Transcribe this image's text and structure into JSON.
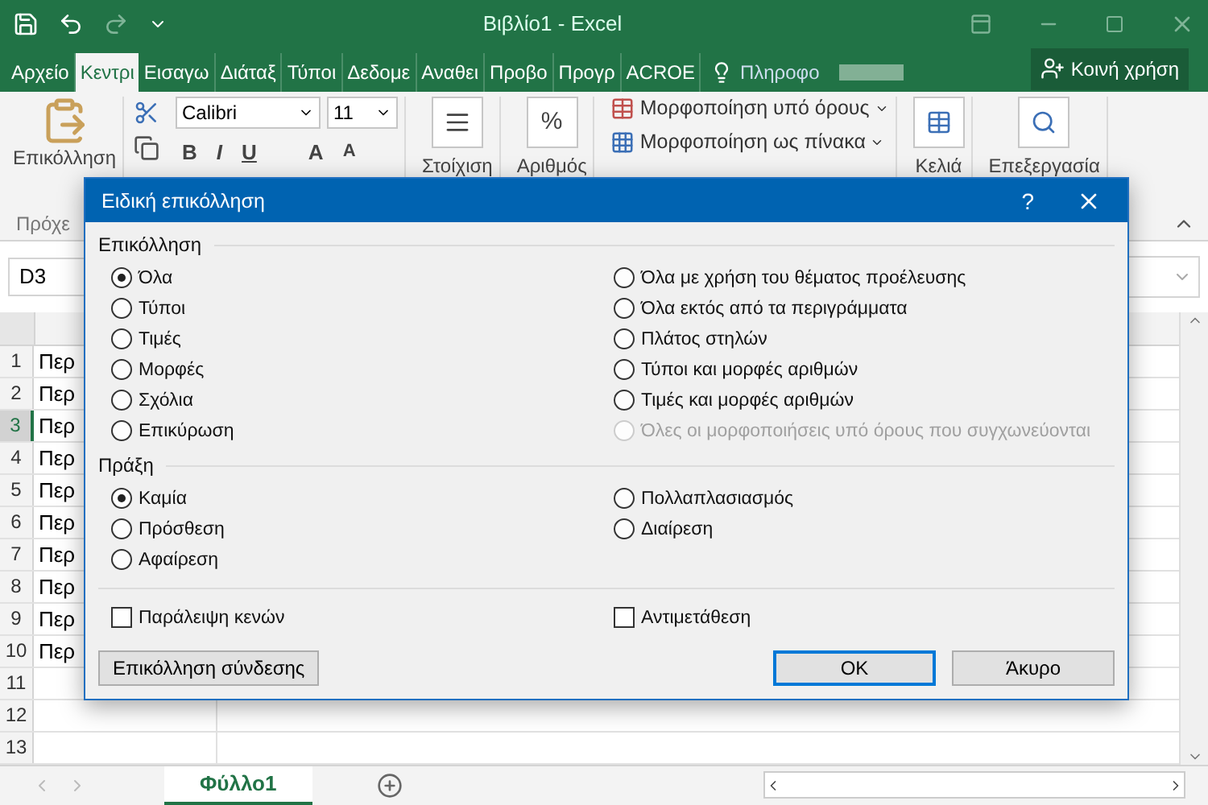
{
  "window": {
    "title": "Βιβλίο1 - Excel"
  },
  "ribbon_tabs": [
    {
      "label": "Αρχείο",
      "selected": false
    },
    {
      "label": "Κεντρι",
      "selected": true
    },
    {
      "label": "Εισαγω",
      "selected": false
    },
    {
      "label": "Διάταξ",
      "selected": false
    },
    {
      "label": "Τύποι",
      "selected": false
    },
    {
      "label": "Δεδομε",
      "selected": false
    },
    {
      "label": "Αναθει",
      "selected": false
    },
    {
      "label": "Προβο",
      "selected": false
    },
    {
      "label": "Προγρ",
      "selected": false
    },
    {
      "label": "ACROE",
      "selected": false
    }
  ],
  "tell_me": "Πληροφο",
  "share_button": "Κοινή χρήση",
  "ribbon": {
    "paste": "Επικόλληση",
    "font_name": "Calibri",
    "font_size": "11",
    "bold": "B",
    "italic": "I",
    "underline": "U",
    "grow_font": "A",
    "shrink_font": "A",
    "alignment": "Στοίχιση",
    "number_symbol": "%",
    "number": "Αριθμός",
    "conditional_formatting": "Μορφοποίηση υπό όρους",
    "format_as_table": "Μορφοποίηση ως πίνακα",
    "cells": "Κελιά",
    "editing": "Επεξεργασία",
    "group_label": "Πρόχε"
  },
  "name_box": "D3",
  "rows": [
    {
      "number": "1",
      "cell": "Περ",
      "selected": false
    },
    {
      "number": "2",
      "cell": "Περ",
      "selected": false
    },
    {
      "number": "3",
      "cell": "Περ",
      "selected": true
    },
    {
      "number": "4",
      "cell": "Περ",
      "selected": false
    },
    {
      "number": "5",
      "cell": "Περ",
      "selected": false
    },
    {
      "number": "6",
      "cell": "Περ",
      "selected": false
    },
    {
      "number": "7",
      "cell": "Περ",
      "selected": false
    },
    {
      "number": "8",
      "cell": "Περ",
      "selected": false
    },
    {
      "number": "9",
      "cell": "Περ",
      "selected": false
    },
    {
      "number": "10",
      "cell": "Περ",
      "selected": false
    },
    {
      "number": "11",
      "selected": false
    },
    {
      "number": "12",
      "selected": false
    },
    {
      "number": "13",
      "selected": false
    }
  ],
  "sheet_tabs": [
    {
      "label": "Φύλλο1",
      "selected": true
    }
  ],
  "dialog": {
    "title": "Ειδική επικόλληση",
    "help": "?",
    "paste": {
      "label": "Επικόλληση",
      "left": [
        {
          "label": "Όλα",
          "selected": true,
          "disabled": false
        },
        {
          "label": "Τύποι",
          "selected": false,
          "disabled": false
        },
        {
          "label": "Τιμές",
          "selected": false,
          "disabled": false
        },
        {
          "label": "Μορφές",
          "selected": false,
          "disabled": false
        },
        {
          "label": "Σχόλια",
          "selected": false,
          "disabled": false
        },
        {
          "label": "Επικύρωση",
          "selected": false,
          "disabled": false
        }
      ],
      "right": [
        {
          "label": "Όλα με χρήση του θέματος προέλευσης",
          "selected": false,
          "disabled": false
        },
        {
          "label": "Όλα εκτός από τα περιγράμματα",
          "selected": false,
          "disabled": false
        },
        {
          "label": "Πλάτος στηλών",
          "selected": false,
          "disabled": false
        },
        {
          "label": "Τύποι και μορφές αριθμών",
          "selected": false,
          "disabled": false
        },
        {
          "label": "Τιμές και μορφές αριθμών",
          "selected": false,
          "disabled": false
        },
        {
          "label": "Όλες οι μορφοποιήσεις υπό όρους που συγχωνεύονται",
          "selected": false,
          "disabled": true
        }
      ]
    },
    "operation": {
      "label": "Πράξη",
      "left": [
        {
          "label": "Καμία",
          "selected": true,
          "disabled": false
        },
        {
          "label": "Πρόσθεση",
          "selected": false,
          "disabled": false
        },
        {
          "label": "Αφαίρεση",
          "selected": false,
          "disabled": false
        }
      ],
      "right": [
        {
          "label": "Πολλαπλασιασμός",
          "selected": false,
          "disabled": false
        },
        {
          "label": "Διαίρεση",
          "selected": false,
          "disabled": false
        }
      ]
    },
    "checkboxes": [
      {
        "label": "Παράλειψη κενών",
        "checked": false
      },
      {
        "label": "Αντιμετάθεση",
        "checked": false
      }
    ],
    "paste_link_button": "Επικόλληση σύνδεσης",
    "ok_button": "OK",
    "cancel_button": "Άκυρο"
  }
}
